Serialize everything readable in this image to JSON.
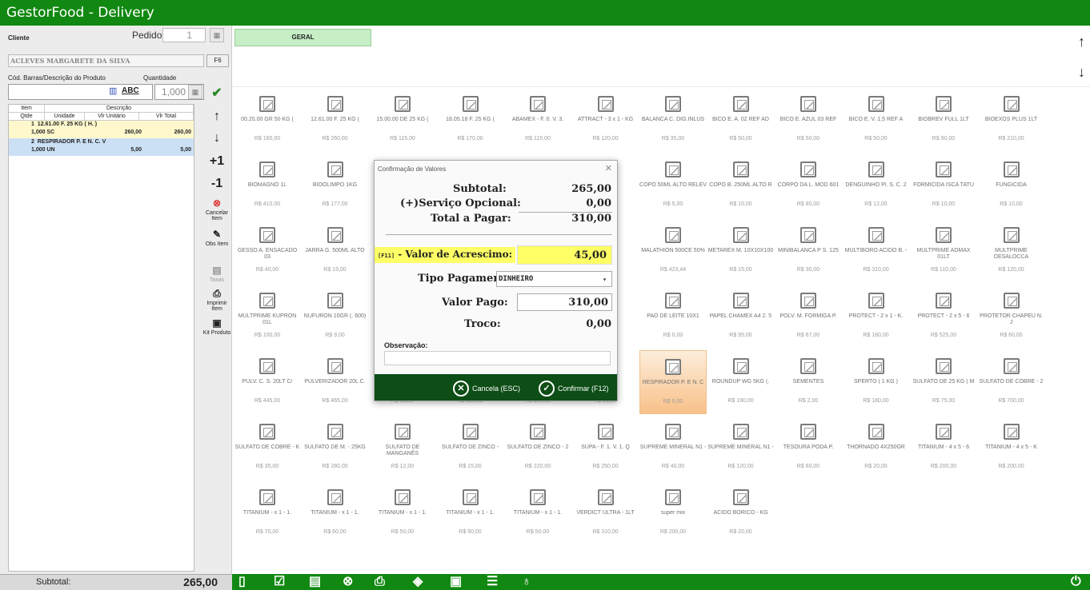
{
  "window": {
    "title": "GestorFood - Delivery"
  },
  "left": {
    "cliente_label": "Cliente",
    "pedido_label": "Pedido",
    "pedido_value": "1",
    "cliente_value": "ACLEVES MARGARETE DA SILVA",
    "f6_label": "F6",
    "codigo_label": "Cód. Barras/Descrição  do Produto",
    "quantidade_label": "Quantidade",
    "abc_label": "ABC",
    "quantidade_value": "1,000",
    "table_headers": {
      "item": "Item",
      "descricao": "Descrição",
      "qtde": "Qtde",
      "unidade": "Unidade",
      "vlr_unitario": "Vlr Unitário",
      "vlr_total": "Vlr Total"
    },
    "items": [
      {
        "num": "1",
        "desc": "12.61.00 F. 25 KG ( H. )",
        "qtde": "1,000 SC",
        "unit": "260,00",
        "total": "260,00"
      },
      {
        "num": "2",
        "desc": "RESPIRADOR P. E N. C. V",
        "qtde": "1,000 UN",
        "unit": "5,00",
        "total": "5,00"
      }
    ],
    "subtotal_label": "Subtotal:",
    "subtotal_value": "265,00"
  },
  "side_tools": {
    "plus_one": "+1",
    "minus_one": "-1",
    "cancelar": "Cancelar Item",
    "obs": "Obs Item",
    "taxas": "Taxas",
    "imprimir": "Imprimir Item",
    "kit": "Kit Produto"
  },
  "tab": {
    "geral": "GERAL"
  },
  "products": [
    {
      "name": "00.20.00 GR 50 KG (",
      "price": "R$ 160,00"
    },
    {
      "name": "12.61.00 F. 25 KG (",
      "price": "R$ 260,00"
    },
    {
      "name": "15.00.00 DE 25 KG (",
      "price": "R$ 115,00"
    },
    {
      "name": "18.05.18 F. 25 KG (",
      "price": "R$ 170,00"
    },
    {
      "name": "ABAMEX - F. 0. V. 3.",
      "price": "R$ 115,00"
    },
    {
      "name": "ATTRACT - 3 x 1 - KG",
      "price": "R$ 120,00"
    },
    {
      "name": "BALANCA C. DIG.INLUS",
      "price": "R$ 35,00"
    },
    {
      "name": "BICO E. A. 02 REF AD",
      "price": "R$ 50,00"
    },
    {
      "name": "BICO E. AZUL 03 REF",
      "price": "R$ 50,00"
    },
    {
      "name": "BICO E. V. 1,5 REF A",
      "price": "R$ 50,00"
    },
    {
      "name": "BIOBREV FULL 1LT",
      "price": "R$ 90,00"
    },
    {
      "name": "BIOEXOS PLUS 1LT",
      "price": "R$ 210,00"
    },
    {
      "name": "BIOMAGNO 1L",
      "price": "R$ 410,00"
    },
    {
      "name": "BIOOLIMPO 1KG",
      "price": "R$ 177,00"
    },
    {
      "name": "",
      "price": ""
    },
    {
      "name": "",
      "price": ""
    },
    {
      "name": "",
      "price": ""
    },
    {
      "name": "LTO",
      "price": ""
    },
    {
      "name": "COPO 50ML ALTO RELEV",
      "price": "R$ 5,00"
    },
    {
      "name": "COPO B. 250ML ALTO R",
      "price": "R$ 10,00"
    },
    {
      "name": "CORPO DA L. MOD 601",
      "price": "R$ 80,00"
    },
    {
      "name": "DENGUINHO Pl. S. C. 2",
      "price": "R$ 12,00"
    },
    {
      "name": "FORMICIDA ISCA TATU",
      "price": "R$ 10,00"
    },
    {
      "name": "FUNGICIDA",
      "price": "R$ 10,00"
    },
    {
      "name": "GESSO A. ENSACADO 03",
      "price": "R$ 40,00"
    },
    {
      "name": "JARRA G. 500ML ALTO",
      "price": "R$ 15,00"
    },
    {
      "name": "",
      "price": ""
    },
    {
      "name": "",
      "price": ""
    },
    {
      "name": "",
      "price": ""
    },
    {
      "name": "IOS P",
      "price": ""
    },
    {
      "name": "MALATHION 500CE 50%",
      "price": "R$ 423,44"
    },
    {
      "name": "METAREX M. 10X10X100",
      "price": "R$ 15,00"
    },
    {
      "name": "MINIBALANCA P S. 125",
      "price": "R$ 30,00"
    },
    {
      "name": "MULTIBORO ACIDO B. -",
      "price": "R$ 310,00"
    },
    {
      "name": "MULTPRIME ADMAX 01LT",
      "price": "R$ 110,00"
    },
    {
      "name": "MULTPRIME DESALOCCA",
      "price": "R$ 120,00"
    },
    {
      "name": "MULTPRIME KUPRON 01L",
      "price": "R$ 100,00"
    },
    {
      "name": "NUFURON 10GR (. 600)",
      "price": "R$ 9,00"
    },
    {
      "name": "",
      "price": ""
    },
    {
      "name": "",
      "price": ""
    },
    {
      "name": "",
      "price": ""
    },
    {
      "name": "TRAD",
      "price": ""
    },
    {
      "name": "PAO DE LEITE 10X1",
      "price": "R$ 0,00"
    },
    {
      "name": "PAPEL CHAMEX A4 2. 5",
      "price": "R$ 95,00"
    },
    {
      "name": "POLV. M. FORMIGA P.",
      "price": "R$ 67,00"
    },
    {
      "name": "PROTECT - 2 x 1 - K.",
      "price": "R$ 180,00"
    },
    {
      "name": "PROTECT - 2 x 5 - 6",
      "price": "R$ 525,00"
    },
    {
      "name": "PROTETOR CHAPEU N. J",
      "price": "R$ 60,00"
    },
    {
      "name": "PULV. C. S. 20LT C/",
      "price": "R$ 445,00"
    },
    {
      "name": "PULVERIZADOR 20L C.",
      "price": "R$ 465,00"
    },
    {
      "name": "KG",
      "price": "R$ 10,00"
    },
    {
      "name": "",
      "price": "R$ 180,00"
    },
    {
      "name": "",
      "price": "R$ 180,00"
    },
    {
      "name": "CTO 90",
      "price": "R$ 50,00"
    },
    {
      "name": "RESPIRADOR P. E N. C",
      "price": "R$ 5,00"
    },
    {
      "name": "ROUNDUP WG 5KG (.",
      "price": "R$ 190,00"
    },
    {
      "name": "SEMENTES",
      "price": "R$ 2,00"
    },
    {
      "name": "SPERTO ( 1 KG )",
      "price": "R$ 180,00"
    },
    {
      "name": "SULFATO DE 25 KG ( M",
      "price": "R$ 75,00"
    },
    {
      "name": "SULFATO DE COBRE - 2",
      "price": "R$ 700,00"
    },
    {
      "name": "SULFATO DE COBRE - K",
      "price": "R$ 35,00"
    },
    {
      "name": "SULFATO DE M. - 25KG",
      "price": "R$ 280,00"
    },
    {
      "name": "SULFATO DE MANGANÊS",
      "price": "R$ 12,00"
    },
    {
      "name": "SULFATO DE ZINCO -",
      "price": "R$ 15,00"
    },
    {
      "name": "SULFATO DE ZINCO - 2",
      "price": "R$ 220,00"
    },
    {
      "name": "SUPA - F. 1. V. 1. Q",
      "price": "R$ 250,00"
    },
    {
      "name": "SUPREME MINERAL N1 -",
      "price": "R$ 40,00"
    },
    {
      "name": "SUPREME MINERAL N1 -",
      "price": "R$ 120,00"
    },
    {
      "name": "TESOURA PODA P.",
      "price": "R$ 60,00"
    },
    {
      "name": "THORNADO 4X250GR",
      "price": "R$ 20,00"
    },
    {
      "name": "TITANIUM - 4 x 5 - 6",
      "price": "R$ 200,00"
    },
    {
      "name": "TITANIUM - 4 x 5 - K",
      "price": "R$ 200,00"
    },
    {
      "name": "TITANIUM - x 1 - 1.",
      "price": "R$ 70,00"
    },
    {
      "name": "TITANIUM - x 1 - 1.",
      "price": "R$ 60,00"
    },
    {
      "name": "TITANIUM - x 1 - 1.",
      "price": "R$ 50,00"
    },
    {
      "name": "TITANIUM - x 1 - 1.",
      "price": "R$ 90,00"
    },
    {
      "name": "TITANIUM - x 1 - 1.",
      "price": "R$ 50,00"
    },
    {
      "name": "VERDICT ULTRA - 1LT",
      "price": "R$ 310,00"
    },
    {
      "name": "super mix",
      "price": "R$ 200,00"
    },
    {
      "name": "ÁCIDO BÓRICO - KG",
      "price": "R$ 20,00"
    }
  ],
  "dialog": {
    "title": "Confirmação de Valores",
    "subtotal_label": "Subtotal:",
    "subtotal_value": "265,00",
    "servico_label": "(+)Serviço Opcional:",
    "servico_value": "0,00",
    "total_label": "Total a Pagar:",
    "total_value": "310,00",
    "acrescimo_key": "[F11]",
    "acrescimo_label": "- Valor de Acrescimo:",
    "acrescimo_value": "45,00",
    "tipo_label": "Tipo Pagamento:",
    "tipo_value": "DINHEIRO",
    "pago_label": "Valor Pago:",
    "pago_value": "310,00",
    "troco_label": "Troco:",
    "troco_value": "0,00",
    "obs_label": "Observação:",
    "cancel_label": "Cancela (ESC)",
    "confirm_label": "Confirmar (F12)"
  }
}
